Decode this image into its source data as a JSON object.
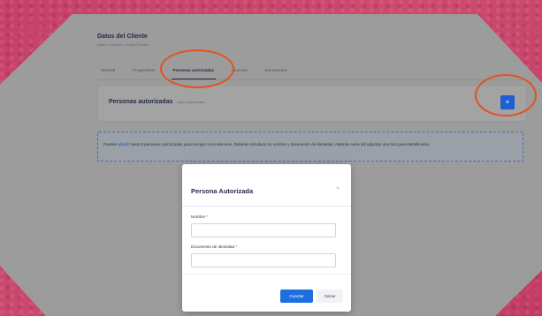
{
  "client": {
    "title": "Datos del Cliente",
    "breadcrumb": "Inicio > Clientes > Client Prueba"
  },
  "tabs": [
    {
      "label": "General"
    },
    {
      "label": "Progenitores"
    },
    {
      "label": "Personas autorizadas"
    },
    {
      "label": "Alumnos"
    },
    {
      "label": "Documentos"
    }
  ],
  "panel": {
    "title": "Personas autorizadas",
    "subtitle": "(max 8 personas)",
    "add_label": "+"
  },
  "info": {
    "prefix": "Puedes ",
    "link": "añadir",
    "text": " hasta 8 personas autorizadas para recoger a los alumnos. Deberás introducir su nombre y documento de identidad. Además sería útil adjuntar una foto para identificarlos."
  },
  "modal": {
    "title": "Persona Autorizada",
    "close_symbol": "✎",
    "fields": [
      {
        "label": "Nombre",
        "required_mark": "*",
        "value": "",
        "placeholder": ""
      },
      {
        "label": "Documento de Identidad",
        "required_mark": "*",
        "value": "",
        "placeholder": ""
      }
    ],
    "save_label": "Guardar",
    "cancel_label": "Cerrar"
  },
  "colors": {
    "annotation": "#e4521f",
    "primary": "#1d6fe0",
    "background": "#c9436a"
  }
}
